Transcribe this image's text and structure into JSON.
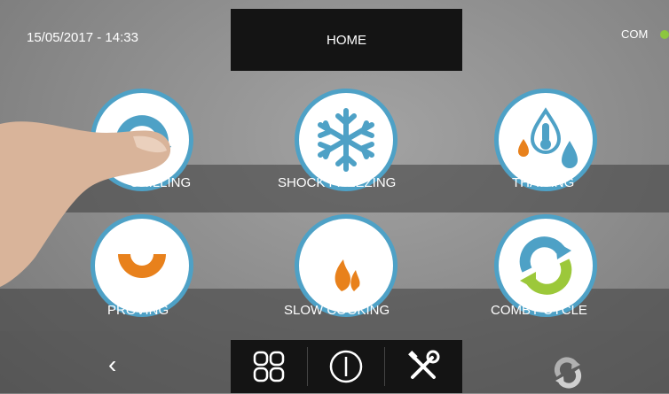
{
  "header": {
    "datetime": "15/05/2017 - 14:33",
    "title": "HOME",
    "com_label": "COM",
    "com_status_color": "#8cc63f"
  },
  "functions": [
    {
      "label": "CHILLING",
      "icon": "chilling-arc-icon"
    },
    {
      "label": "SHOCK FREEZING",
      "icon": "snowflake-icon"
    },
    {
      "label": "THAWING",
      "icon": "thawing-drops-icon"
    },
    {
      "label": "PROVING",
      "icon": "proving-icon"
    },
    {
      "label": "SLOW COOKING",
      "icon": "flame-icon"
    },
    {
      "label": "COMBY CYCLE",
      "icon": "comby-cycle-icon"
    }
  ],
  "colors": {
    "ring": "#4ea1c6",
    "orange": "#e8811c",
    "green": "#9cc83a",
    "blue": "#4ea1c6"
  },
  "nav": {
    "back": "‹",
    "menu_icon": "grid-icon",
    "power_icon": "power-icon",
    "settings_icon": "tools-icon",
    "sync_icon": "sync-icon"
  }
}
